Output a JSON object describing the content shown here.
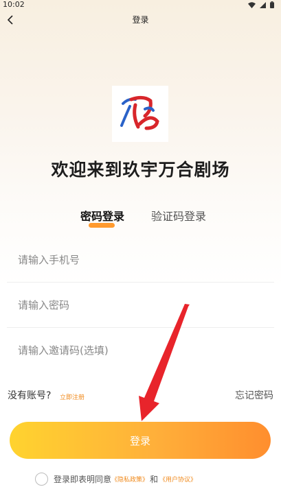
{
  "status_bar": {
    "time": "10:02"
  },
  "nav": {
    "title": "登录"
  },
  "welcome": {
    "title": "欢迎来到玖宇万合剧场"
  },
  "tabs": [
    {
      "label": "密码登录",
      "active": true
    },
    {
      "label": "验证码登录",
      "active": false
    }
  ],
  "form": {
    "phone_placeholder": "请输入手机号",
    "password_placeholder": "请输入密码",
    "invite_placeholder": "请输入邀请码(选填)"
  },
  "links": {
    "no_account": "没有账号?",
    "register": "立即注册",
    "forgot": "忘记密码"
  },
  "login_button": {
    "label": "登录"
  },
  "agreement": {
    "prefix": "登录即表明同意",
    "privacy": "《隐私政策》",
    "and": "和",
    "terms": "《用户协议》"
  },
  "colors": {
    "accent": "#ff9a2e",
    "button_start": "#ffd32f",
    "button_end": "#ff8e2e",
    "link": "#f08a1c",
    "annotation_arrow": "#e8242b"
  }
}
